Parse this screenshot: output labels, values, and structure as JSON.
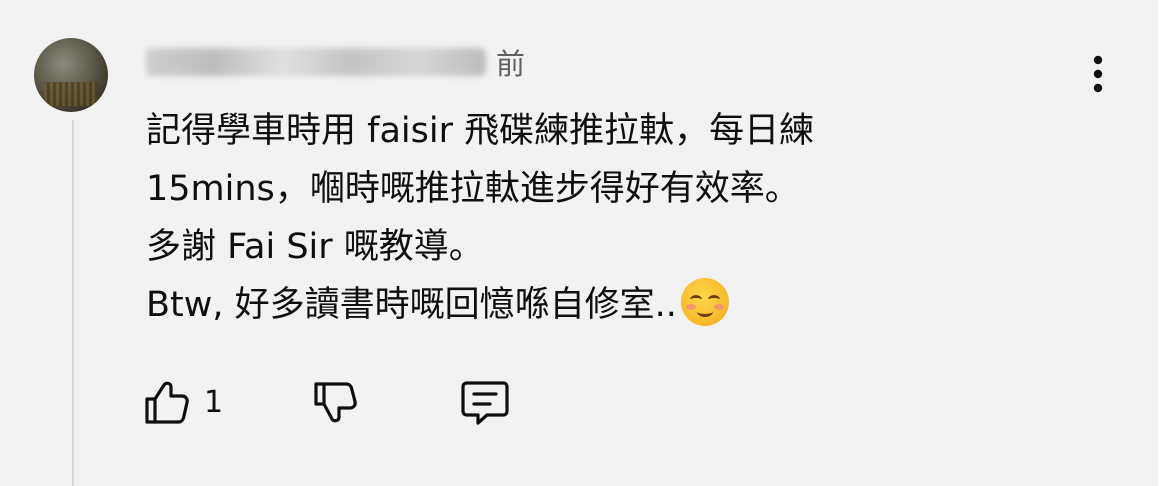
{
  "comment": {
    "author": "",
    "timestamp": "前",
    "lines": [
      "記得學車時用 faisir 飛碟練推拉軚，每日練",
      "15mins，嗰時嘅推拉軚進步得好有效率。",
      "多謝 Fai Sir 嘅教導。",
      "Btw, 好多讀書時嘅回憶喺自修室.."
    ],
    "emoji": "smiling-face-with-blush-emoji"
  },
  "actions": {
    "like_count": "1",
    "like_icon": "thumbs-up-icon",
    "dislike_icon": "thumbs-down-icon",
    "reply_icon": "reply-icon"
  },
  "menu": {
    "icon": "more-vertical-icon"
  },
  "colors": {
    "background": "#f2f2f2",
    "text": "#0f0f0f",
    "meta": "#606060"
  }
}
